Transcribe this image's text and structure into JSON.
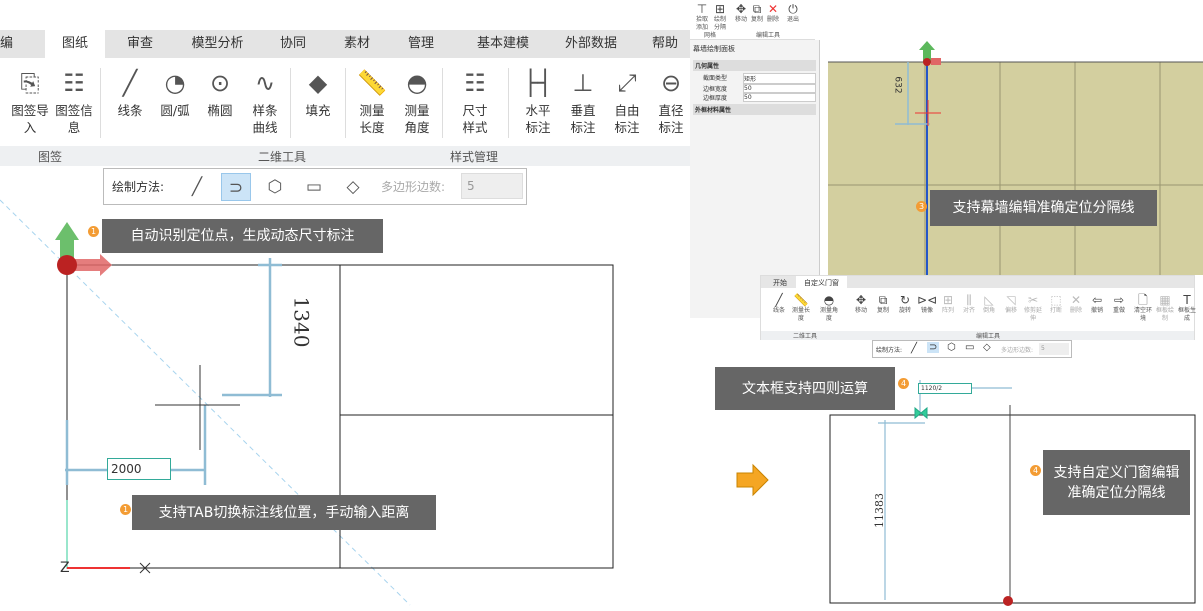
{
  "left": {
    "tabs": [
      "编辑",
      "图纸",
      "审查",
      "模型分析",
      "协同",
      "素材",
      "管理",
      "基本建模",
      "外部数据",
      "帮助"
    ],
    "ribbon": [
      {
        "icon": "title-import-icon",
        "label": "图签导入"
      },
      {
        "icon": "title-info-icon",
        "label": "图签信息"
      },
      {
        "icon": "line-icon",
        "label": "线条"
      },
      {
        "icon": "circle-arc-icon",
        "label": "圆/弧"
      },
      {
        "icon": "ellipse-icon",
        "label": "椭圆"
      },
      {
        "icon": "spline-icon",
        "label": "样条曲线"
      },
      {
        "icon": "fill-icon",
        "label": "填充"
      },
      {
        "icon": "measure-length-icon",
        "label": "测量长度"
      },
      {
        "icon": "measure-angle-icon",
        "label": "测量角度"
      },
      {
        "icon": "dimension-style-icon",
        "label": "尺寸样式"
      },
      {
        "icon": "horizontal-dim-icon",
        "label": "水平标注"
      },
      {
        "icon": "vertical-dim-icon",
        "label": "垂直标注"
      },
      {
        "icon": "free-dim-icon",
        "label": "自由标注"
      },
      {
        "icon": "diameter-dim-icon",
        "label": "直径标注"
      }
    ],
    "groups": [
      "图签",
      "二维工具",
      "样式管理"
    ],
    "draw_method": {
      "label": "绘制方法:",
      "polygon_label": "多边形边数:",
      "polygon_value": "5"
    },
    "dimension_value": "1340",
    "input_value": "2000"
  },
  "top_right": {
    "tools": [
      "拾取添加",
      "绘制分隔",
      "移动",
      "复制",
      "删除",
      "退出"
    ],
    "groups": [
      "网格",
      "编辑工具"
    ],
    "panel_title": "幕墙绘制面板",
    "section1": "几何属性",
    "rows": [
      {
        "k": "截面类型",
        "v": "矩形"
      },
      {
        "k": "边框宽度",
        "v": "50"
      },
      {
        "k": "边框厚度",
        "v": "50"
      }
    ],
    "section2": "外框材料属性",
    "dimension_value": "632"
  },
  "bottom_right": {
    "tabs": [
      "开始",
      "自定义门窗"
    ],
    "tools": [
      "线条",
      "测量长度",
      "测量角度",
      "移动",
      "复制",
      "旋转",
      "镜像",
      "阵列",
      "对齐",
      "倒角",
      "偏移",
      "修剪延伸",
      "打断",
      "删除",
      "撤销",
      "重做",
      "清空环境",
      "框板绘制",
      "框板生成"
    ],
    "groups": [
      "二维工具",
      "编辑工具"
    ],
    "draw_method": {
      "label": "绘制方法:",
      "polygon_label": "多边形边数:",
      "polygon_value": "5"
    },
    "dim_top": "1120/2",
    "dim_side": "11383"
  },
  "callouts": [
    {
      "n": "1",
      "text": "自动识别定位点，生成动态尺寸标注"
    },
    {
      "n": "1",
      "text": "支持TAB切换标注线位置，手动输入距离"
    },
    {
      "n": "3",
      "text": "支持幕墙编辑准确定位分隔线"
    },
    {
      "n": "4",
      "text": "文本框支持四则运算"
    },
    {
      "n": "4",
      "text": "支持自定义门窗编辑准确定位分隔线"
    }
  ],
  "colors": {
    "callout": "#666666",
    "badge": "#f39c34",
    "canvas_olive": "#d3cf9f",
    "dim_line": "#8fbcd4",
    "arrow": "#f5a623"
  }
}
